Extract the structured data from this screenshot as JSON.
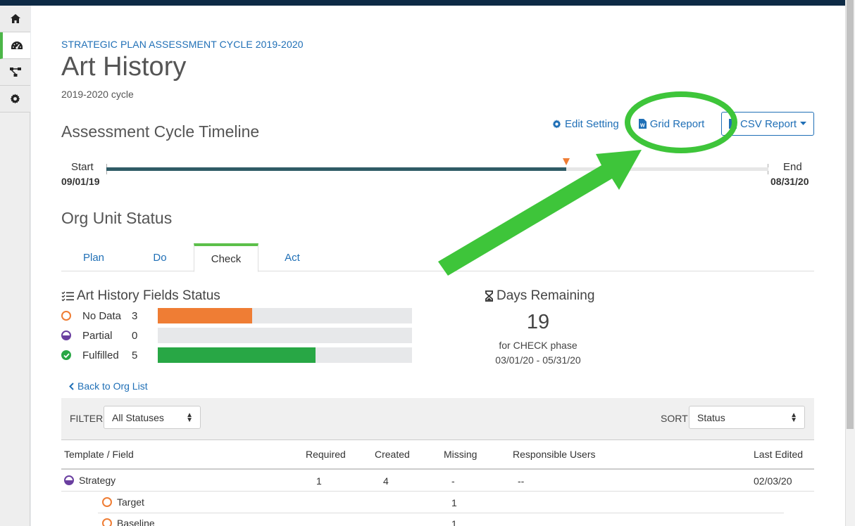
{
  "header": {
    "kicker": "STRATEGIC PLAN ASSESSMENT CYCLE 2019-2020",
    "title": "Art History",
    "subtitle": "2019-2020 cycle"
  },
  "timeline": {
    "heading": "Assessment Cycle Timeline",
    "start_label": "Start",
    "start_date": "09/01/19",
    "end_label": "End",
    "end_date": "08/31/20",
    "progress_fraction": 0.695,
    "track_color": "#2f5b66",
    "marker_color": "#ef7d34"
  },
  "actions": {
    "edit_settings": "Edit Setting",
    "grid_report": "Grid Report",
    "csv_report": "CSV Report"
  },
  "org_status": {
    "heading": "Org Unit Status",
    "tabs": [
      {
        "label": "Plan"
      },
      {
        "label": "Do"
      },
      {
        "label": "Check"
      },
      {
        "label": "Act"
      }
    ],
    "active_tab": "Check"
  },
  "fields_status": {
    "heading": "Art History Fields Status",
    "items": [
      {
        "label": "No Data",
        "count": "3",
        "fraction": 0.37,
        "color": "#ef7d34",
        "icon": "empty-circle-icon"
      },
      {
        "label": "Partial",
        "count": "0",
        "fraction": 0,
        "color": "#6a3fa0",
        "icon": "half-circle-icon"
      },
      {
        "label": "Fulfilled",
        "count": "5",
        "fraction": 0.62,
        "color": "#28a745",
        "icon": "check-circle-icon"
      }
    ]
  },
  "days_remaining": {
    "heading": "Days Remaining",
    "value": "19",
    "phase": "for CHECK phase",
    "range": "03/01/20 - 05/31/20"
  },
  "back_link": "Back to Org List",
  "filter": {
    "label": "FILTER",
    "value": "All Statuses",
    "sort_label": "SORT",
    "sort_value": "Status"
  },
  "table": {
    "headers": [
      "Template / Field",
      "Required",
      "Created",
      "Missing",
      "Responsible Users",
      "Last Edited"
    ],
    "rows": [
      {
        "name": "Strategy",
        "required": "1",
        "created": "4",
        "missing": "-",
        "users": "--",
        "last_edited": "02/03/20",
        "status": "partial"
      },
      {
        "name": "Target",
        "required": "",
        "created": "",
        "missing": "1",
        "users": "",
        "last_edited": "",
        "status": "nodata"
      },
      {
        "name": "Baseline",
        "required": "",
        "created": "",
        "missing": "1",
        "users": "",
        "last_edited": "",
        "status": "nodata"
      }
    ]
  },
  "annotation": {
    "color": "#3ec53a"
  }
}
